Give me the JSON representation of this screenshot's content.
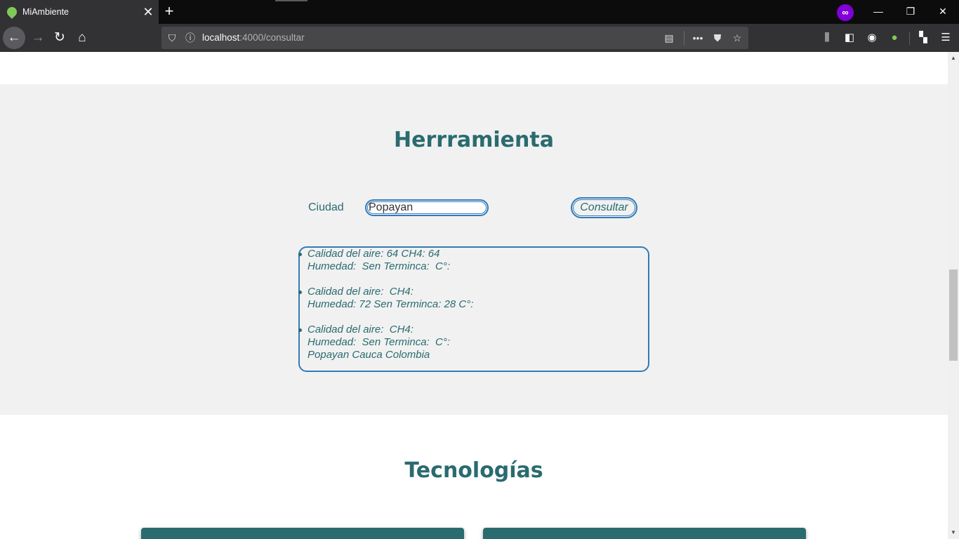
{
  "browser": {
    "tab_title": "MiAmbiente",
    "url_host": "localhost",
    "url_path": ":4000/consultar"
  },
  "tool_section": {
    "title": "Herrramienta",
    "city_label": "Ciudad",
    "city_value": "Popayan",
    "consult_button": "Consultar",
    "results": [
      {
        "line1": "Calidad del aire: 64 CH4: 64",
        "line2": "Humedad:  Sen Terminca:  C°:"
      },
      {
        "line1": "Calidad del aire:  CH4: ",
        "line2": "Humedad: 72 Sen Terminca: 28 C°:"
      },
      {
        "line1": "Calidad del aire:  CH4: ",
        "line2": "Humedad:  Sen Terminca:  C°:",
        "line3": "Popayan Cauca Colombia"
      }
    ]
  },
  "tech_section": {
    "title": "Tecnologías"
  }
}
